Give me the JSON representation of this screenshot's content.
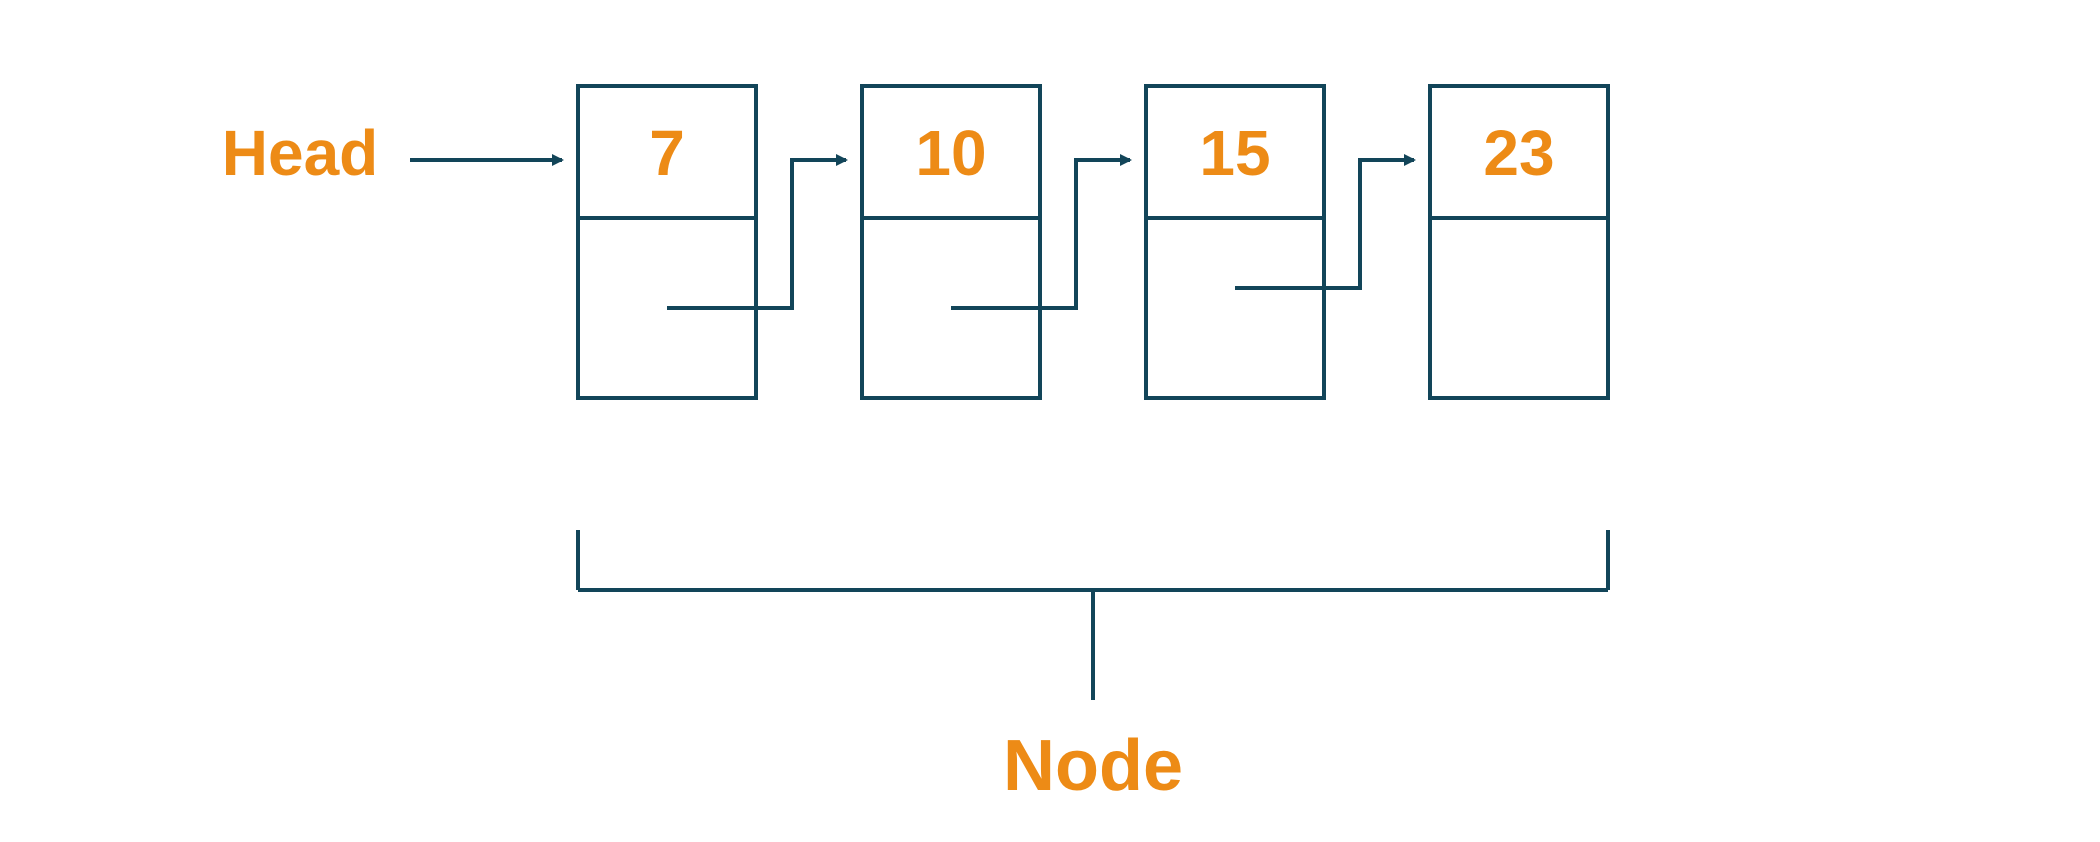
{
  "colors": {
    "accent": "#ed8b16",
    "stroke": "#124559",
    "background": "#ffffff"
  },
  "labels": {
    "head": "Head",
    "node": "Node"
  },
  "nodes": [
    {
      "value": "7"
    },
    {
      "value": "10"
    },
    {
      "value": "15"
    },
    {
      "value": "23"
    }
  ],
  "diagram_type": "singly-linked-list"
}
